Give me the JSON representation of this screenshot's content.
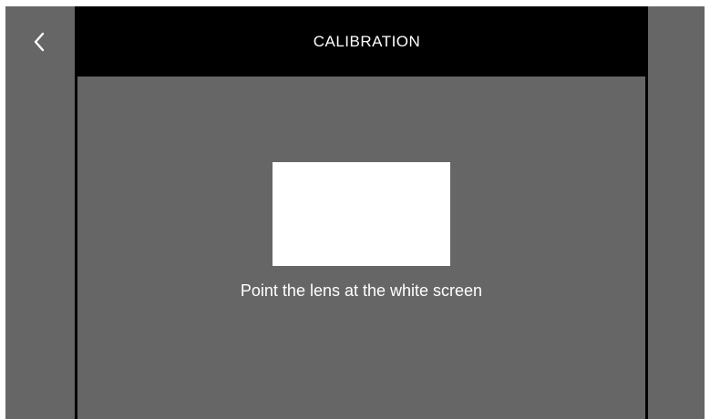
{
  "header": {
    "title": "CALIBRATION",
    "back_icon": "chevron-left-icon"
  },
  "main": {
    "instruction": "Point the lens at the white screen",
    "target_color": "#ffffff"
  },
  "colors": {
    "background": "#666666",
    "header": "#000000",
    "text": "#ffffff"
  }
}
